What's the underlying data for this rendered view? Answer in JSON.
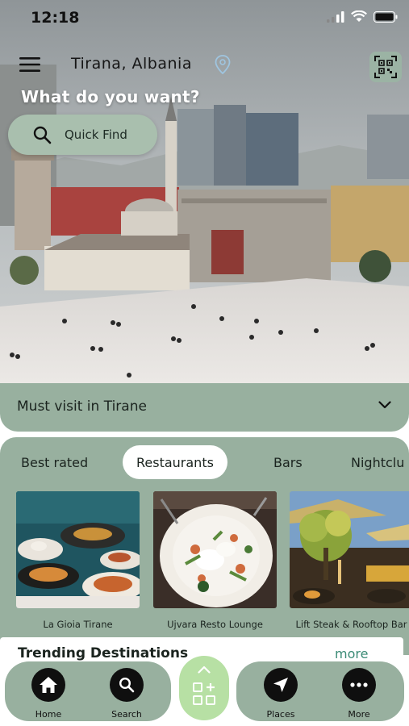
{
  "status_bar": {
    "time": "12:18"
  },
  "header": {
    "location": "Tirana,  Albania",
    "question": "What do you want?",
    "quick_find_label": "Quick Find"
  },
  "must_visit": {
    "label": "Must visit in Tirane"
  },
  "categories": {
    "tabs": [
      "Best rated",
      "Restaurants",
      "Bars",
      "Nightclu"
    ],
    "active_tab": "Restaurants"
  },
  "places": [
    {
      "name": "La Gioia Tirane"
    },
    {
      "name": "Ujvara Resto Lounge"
    },
    {
      "name": "Lift Steak & Rooftop Bar"
    }
  ],
  "trending": {
    "title": "Trending Destinations",
    "more_label": "more"
  },
  "bottom_nav": {
    "items": [
      {
        "label": "Home",
        "icon": "home-icon"
      },
      {
        "label": "Search",
        "icon": "search-icon"
      },
      {
        "label": "Places",
        "icon": "navigation-arrow-icon"
      },
      {
        "label": "More",
        "icon": "more-dots-icon"
      }
    ],
    "center_icon": "grid-plus-icon"
  },
  "colors": {
    "panel_green": "#98b09f",
    "center_button_green": "#b7e0a4",
    "link_teal": "#3b8b76"
  }
}
